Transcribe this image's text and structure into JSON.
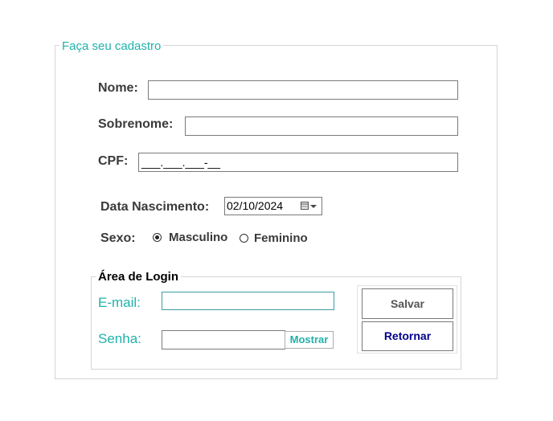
{
  "form": {
    "title": "Faça seu cadastro",
    "nome_label": "Nome:",
    "nome_value": "",
    "sobrenome_label": "Sobrenome:",
    "sobrenome_value": "",
    "cpf_label": "CPF:",
    "cpf_value": "___.___.___-__",
    "data_label": "Data Nascimento:",
    "data_value": "02/10/2024",
    "sexo_label": "Sexo:",
    "sexo_options": [
      "Masculino",
      "Feminino"
    ],
    "sexo_selected": "Masculino"
  },
  "login": {
    "title": "Área de Login",
    "email_label": "E-mail:",
    "email_value": "",
    "senha_label": "Senha:",
    "senha_value": "",
    "mostrar_label": "Mostrar"
  },
  "actions": {
    "salvar_label": "Salvar",
    "retornar_label": "Retornar"
  },
  "colors": {
    "accent_teal": "#20b2aa",
    "retornar_text": "#00008b",
    "label_text": "#3a3a3a"
  },
  "icons": {
    "date_picker": "calendar-icon",
    "dropdown": "chevron-down-icon"
  }
}
